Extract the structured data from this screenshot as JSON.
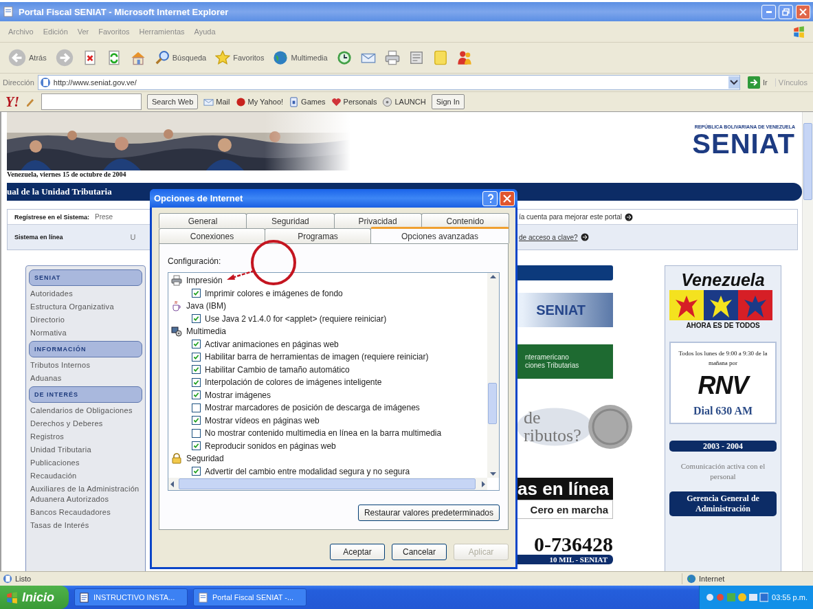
{
  "window": {
    "title": "Portal Fiscal SENIAT - Microsoft Internet Explorer"
  },
  "menu": [
    "Archivo",
    "Edición",
    "Ver",
    "Favoritos",
    "Herramientas",
    "Ayuda"
  ],
  "toolbar": [
    {
      "kind": "back",
      "label": "Atrás"
    },
    {
      "kind": "forward"
    },
    {
      "kind": "stop"
    },
    {
      "kind": "refresh"
    },
    {
      "kind": "home"
    },
    {
      "kind": "search",
      "label": "Búsqueda"
    },
    {
      "kind": "favorites",
      "label": "Favoritos"
    },
    {
      "kind": "media",
      "label": "Multimedia"
    },
    {
      "kind": "history"
    },
    {
      "kind": "mail"
    },
    {
      "kind": "print"
    },
    {
      "kind": "edit"
    },
    {
      "kind": "notes"
    },
    {
      "kind": "messenger"
    }
  ],
  "address": {
    "label": "Dirección",
    "url": "http://www.seniat.gov.ve/",
    "go": "Ir",
    "links": "Vínculos"
  },
  "yahoo_bar": {
    "logo": "Y!",
    "search_button": "Search Web",
    "items": [
      {
        "kind": "mail",
        "label": "Mail"
      },
      {
        "kind": "myyahoo",
        "label": "My Yahoo!"
      },
      {
        "kind": "games",
        "label": "Games"
      },
      {
        "kind": "personals",
        "label": "Personals"
      },
      {
        "kind": "launch",
        "label": "LAUNCH"
      }
    ],
    "sign_in": "Sign In"
  },
  "page": {
    "logo": {
      "caption": "REPÚBLICA BOLIVARIANA DE VENEZUELA",
      "name": "SENIAT"
    },
    "date": "Venezuela, viernes 15 de octubre de 2004",
    "banner": "ual de la Unidad Tributaria",
    "register": {
      "label": "Regístrese en el Sistema:",
      "text": "Prese",
      "right": "ía cuenta para mejorar este portal"
    },
    "online": {
      "label": "Sistema en línea",
      "text": "U",
      "link": "de acceso a clave?"
    },
    "sidebar": [
      {
        "title": "SENIAT",
        "items": [
          "Autoridades",
          "Estructura Organizativa",
          "Directorio",
          "Normativa"
        ]
      },
      {
        "title": "INFORMACIÓN",
        "items": [
          "Tributos Internos",
          "Aduanas"
        ]
      },
      {
        "title": "DE INTERÉS",
        "items": [
          "Calendarios de Obligaciones",
          "Derechos y Deberes",
          "Registros",
          "Unidad Tributaria",
          "Publicaciones",
          "Recaudación",
          "Auxiliares de la Administración Aduanera Autorizados",
          "Bancos Recaudadores",
          "Tasas de Interés"
        ]
      }
    ],
    "middle": {
      "jornada": "SENIAT",
      "green_banner": [
        "nteramericano",
        "ciones Tributarias"
      ],
      "map_text": [
        "de",
        "ributos?"
      ],
      "online_title": "as en línea",
      "online_subtitle": "Cero en marcha",
      "phone": "0-736428",
      "phone_caption": "10 MIL - SENIAT"
    },
    "right": {
      "venezuela": "Venezuela",
      "slogan": "AHORA ES DE TODOS",
      "radio_text": "Todos los lunes de 9:00 a 9:30 de la mañana por",
      "radio_logo": "RNV",
      "dial": "Dial 630 AM",
      "years": "2003 - 2004",
      "communication": "Comunicación activa con el personal",
      "management": "Gerencia General de Administración"
    }
  },
  "dialog": {
    "title": "Opciones de Internet",
    "tab_rows": [
      {
        "tabs": [
          {
            "label": "General",
            "selected": false
          },
          {
            "label": "Seguridad",
            "selected": false
          },
          {
            "label": "Privacidad",
            "selected": false
          },
          {
            "label": "Contenido",
            "selected": false
          }
        ]
      },
      {
        "tabs": [
          {
            "label": "Conexiones",
            "selected": false
          },
          {
            "label": "Programas",
            "selected": false
          },
          {
            "label": "Opciones avanzadas",
            "selected": true
          }
        ]
      }
    ],
    "settings_label": "Configuración:",
    "settings": [
      {
        "kind": "printer",
        "label": "Impresión",
        "children": [
          {
            "label": "Imprimir colores e imágenes de fondo",
            "checked": true
          }
        ]
      },
      {
        "kind": "java",
        "label": "Java (IBM)",
        "children": [
          {
            "label": "Use Java 2 v1.4.0 for <applet> (requiere reiniciar)",
            "checked": true
          }
        ]
      },
      {
        "kind": "multimedia",
        "label": "Multimedia",
        "children": [
          {
            "label": "Activar animaciones en páginas web",
            "checked": true
          },
          {
            "label": "Habilitar barra de herramientas de imagen (requiere reiniciar)",
            "checked": true
          },
          {
            "label": "Habilitar Cambio de tamaño automático",
            "checked": true
          },
          {
            "label": "Interpolación de colores de imágenes inteligente",
            "checked": true
          },
          {
            "label": "Mostrar imágenes",
            "checked": true
          },
          {
            "label": "Mostrar marcadores de posición de descarga de imágenes",
            "checked": false
          },
          {
            "label": "Mostrar vídeos en páginas web",
            "checked": true
          },
          {
            "label": "No mostrar contenido multimedia en línea en la barra multimedia",
            "checked": false
          },
          {
            "label": "Reproducir sonidos en páginas web",
            "checked": true
          }
        ]
      },
      {
        "kind": "security",
        "label": "Seguridad",
        "children": [
          {
            "label": "Advertir del cambio entre modalidad segura y no segura",
            "checked": true
          }
        ]
      }
    ],
    "restore": "Restaurar valores predeterminados",
    "buttons": [
      {
        "label": "Aceptar",
        "disabled": false
      },
      {
        "label": "Cancelar",
        "disabled": false
      },
      {
        "label": "Aplicar",
        "disabled": true
      }
    ]
  },
  "status_bar": {
    "text": "Listo",
    "zone": "Internet"
  },
  "taskbar": {
    "start": "Inicio",
    "tasks": [
      {
        "label": "INSTRUCTIVO INSTA...",
        "selected": false
      },
      {
        "label": "Portal Fiscal SENIAT -...",
        "selected": false
      }
    ],
    "clock": "03:55 p.m."
  }
}
